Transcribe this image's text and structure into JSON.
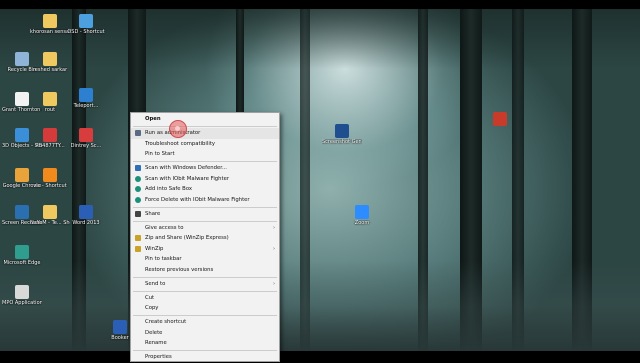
{
  "desktop": {
    "icons": [
      {
        "label": "Recycle Bin",
        "icon": "recycle-bin-icon",
        "color": "#8fb4d8"
      },
      {
        "label": "Grant Thornton Auth...",
        "icon": "document-icon",
        "color": "#f2f2f2"
      },
      {
        "label": "3D Objects - Shortcut",
        "icon": "cube-icon",
        "color": "#3a8fd8"
      },
      {
        "label": "Google Chrome",
        "icon": "chrome-icon",
        "color": "#e8a33a"
      },
      {
        "label": "Screen Recorder",
        "icon": "recorder-icon",
        "color": "#2a6fb0"
      },
      {
        "label": "Microsoft Edge",
        "icon": "edge-icon",
        "color": "#2f9e8f"
      },
      {
        "label": "MPO Application",
        "icon": "app-icon",
        "color": "#d9d9d9"
      },
      {
        "label": "khorosan sensas",
        "icon": "folder-icon",
        "color": "#f0c860"
      },
      {
        "label": "reshed sarkar",
        "icon": "folder-icon",
        "color": "#f0c860"
      },
      {
        "label": "rout",
        "icon": "folder-icon",
        "color": "#f0c860"
      },
      {
        "label": "RB4877TY...",
        "icon": "pdf-icon",
        "color": "#d63b3b"
      },
      {
        "label": "vlc - Shortcut",
        "icon": "vlc-icon",
        "color": "#f08a1c"
      },
      {
        "label": "NaYeM - Te... Shortcut",
        "icon": "folder-icon",
        "color": "#f0c860"
      },
      {
        "label": "OSD - Shortcut",
        "icon": "shortcut-icon",
        "color": "#4da0e0"
      },
      {
        "label": "Teleport...",
        "icon": "app-icon",
        "color": "#2d7fd0"
      },
      {
        "label": "Dintrey Sc...",
        "icon": "app-icon",
        "color": "#d83d3d"
      },
      {
        "label": "Word 2013",
        "icon": "word-icon",
        "color": "#2b5fb5"
      },
      {
        "label": "Booker",
        "icon": "app-icon",
        "color": "#2b5fb5"
      },
      {
        "label": "Screenshot Generator",
        "icon": "app-icon",
        "color": "#1f4f8f"
      },
      {
        "label": "Zoom",
        "icon": "zoom-icon",
        "color": "#2d8cff"
      },
      {
        "label": "",
        "icon": "app-icon",
        "color": "#c83a2a"
      }
    ]
  },
  "context_menu": {
    "items": [
      {
        "label": "Open",
        "bold": true
      },
      {
        "label": "Run as administrator",
        "icon": "shield-icon"
      },
      {
        "label": "Troubleshoot compatibility"
      },
      {
        "label": "Pin to Start"
      },
      {
        "label": "Scan with Windows Defender...",
        "icon": "defender-icon"
      },
      {
        "label": "Scan with IObit Malware Fighter",
        "icon": "iobit-icon"
      },
      {
        "label": "Add into Safe Box",
        "icon": "iobit-icon"
      },
      {
        "label": "Force Delete with IObit Malware Fighter",
        "icon": "iobit-icon"
      },
      {
        "label": "Share",
        "icon": "share-icon"
      },
      {
        "label": "Give access to",
        "submenu": true
      },
      {
        "label": "Zip and Share (WinZip Express)",
        "icon": "winzip-icon"
      },
      {
        "label": "WinZip",
        "icon": "winzip-icon",
        "submenu": true
      },
      {
        "label": "Pin to taskbar"
      },
      {
        "label": "Restore previous versions"
      },
      {
        "label": "Send to",
        "submenu": true
      },
      {
        "label": "Cut"
      },
      {
        "label": "Copy"
      },
      {
        "label": "Create shortcut"
      },
      {
        "label": "Delete"
      },
      {
        "label": "Rename"
      },
      {
        "label": "Properties"
      }
    ]
  },
  "colors": {
    "menu_bg": "#f2f2f2",
    "highlight": "#e5e5e5",
    "iobit": "#1a8f7a",
    "defender": "#2e6fb5"
  }
}
